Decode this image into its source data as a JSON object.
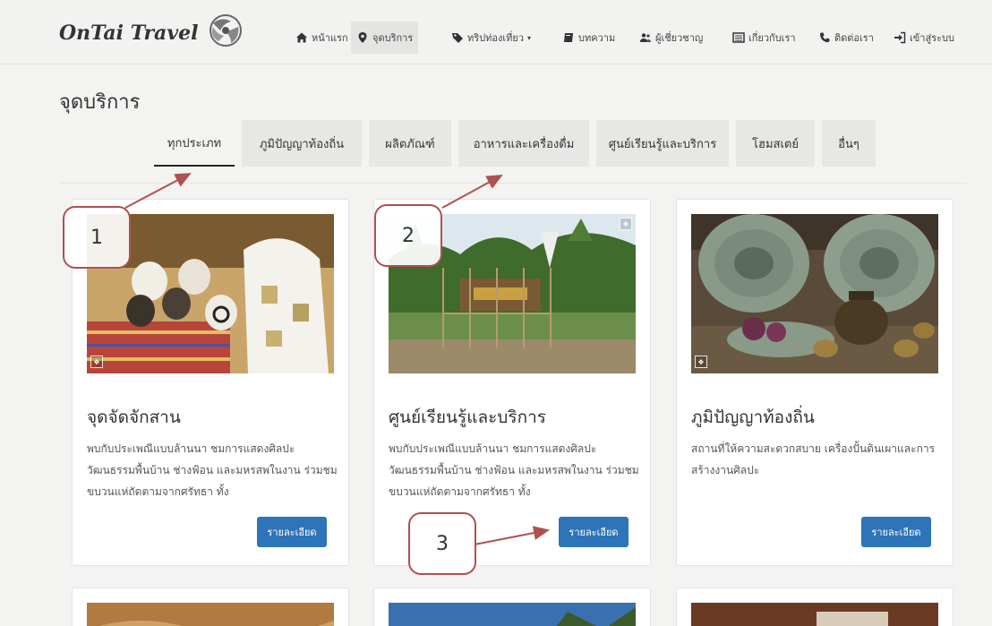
{
  "brand": {
    "name": "OnTai Travel"
  },
  "nav": {
    "items": [
      {
        "label": "หน้าแรก",
        "icon": "home-icon"
      },
      {
        "label": "จุดบริการ",
        "icon": "map-marker-icon",
        "active": true
      },
      {
        "label": "ทริปท่องเที่ยว",
        "icon": "tag-icon",
        "dropdown": true
      },
      {
        "label": "บทความ",
        "icon": "book-icon"
      },
      {
        "label": "ผู้เชี่ยวชาญ",
        "icon": "users-icon"
      },
      {
        "label": "เกี่ยวกับเรา",
        "icon": "list-icon"
      },
      {
        "label": "ติดต่อเรา",
        "icon": "phone-icon"
      },
      {
        "label": "เข้าสู่ระบบ",
        "icon": "sign-in-icon"
      }
    ]
  },
  "page": {
    "title": "จุดบริการ"
  },
  "tabs": [
    {
      "label": "ทุกประเภท",
      "active": true
    },
    {
      "label": "ภูมิปัญญาท้องถิ่น"
    },
    {
      "label": "ผลิตภัณฑ์"
    },
    {
      "label": "อาหารและเครื่องดื่ม"
    },
    {
      "label": "ศูนย์เรียนรู้และบริการ"
    },
    {
      "label": "โฮมสเตย์"
    },
    {
      "label": "อื่นๆ"
    }
  ],
  "cards": [
    {
      "title": "จุดจัดจักสาน",
      "description": "พบกับประเพณีแบบล้านนา ชมการแสดงศิลปะวัฒนธรรมพื้นบ้าน ช่างฟ้อน และมหรสพในงาน ร่วมชมขบวนแห่ถัดตามจากศรัทธา ทั้ง",
      "button": "รายละเอียด"
    },
    {
      "title": "ศูนย์เรียนรู้และบริการ",
      "description": "พบกับประเพณีแบบล้านนา ชมการแสดงศิลปะวัฒนธรรมพื้นบ้าน ช่างฟ้อน และมหรสพในงาน ร่วมชมขบวนแห่ถัดตามจากศรัทธา ทั้ง",
      "button": "รายละเอียด"
    },
    {
      "title": "ภูมิปัญญาท้องถิ่น",
      "description": "สถานที่ให้ความสะดวกสบาย เครื่องปั้นดินเผาและการสร้างงานศิลปะ",
      "button": "รายละเอียด"
    }
  ],
  "annotations": [
    "1",
    "2",
    "3"
  ],
  "colors": {
    "button": "#2e74b8",
    "annotation": "#b05050",
    "background": "#f3f3f1"
  }
}
